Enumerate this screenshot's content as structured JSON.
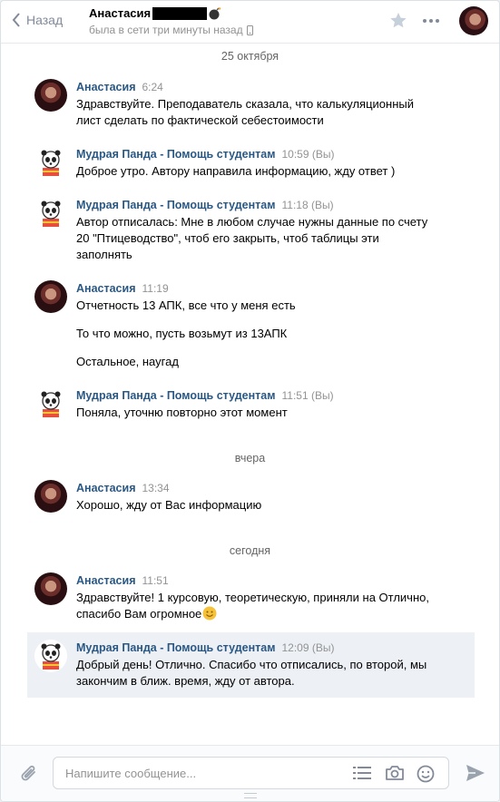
{
  "header": {
    "back_label": "Назад",
    "contact_name": "Анастасия",
    "status": "была в сети три минуты назад"
  },
  "dates": [
    "25 октября",
    "вчера",
    "сегодня"
  ],
  "messages": [
    {
      "author": "Анастасия",
      "time": "6:24",
      "lines": [
        "Здравствуйте. Преподаватель сказала, что калькуляционный лист сделать по фактической себестоимости"
      ]
    },
    {
      "author": "Мудрая Панда - Помощь студентам",
      "time": "10:59 (Вы)",
      "lines": [
        "Доброе утро. Автору направила информацию, жду ответ )"
      ]
    },
    {
      "author": "Мудрая Панда - Помощь студентам",
      "time": "11:18 (Вы)",
      "lines": [
        "Автор отписалась: Мне в любом случае нужны данные по счету 20 \"Птицеводство\", чтоб его закрыть, чтоб таблицы эти заполнять"
      ]
    },
    {
      "author": "Анастасия",
      "time": "11:19",
      "lines": [
        "Отчетность 13 АПК, все что у меня есть",
        "То что можно, пусть возьмут из 13АПК",
        "Остальное, наугад"
      ]
    },
    {
      "author": "Мудрая Панда - Помощь студентам",
      "time": "11:51 (Вы)",
      "lines": [
        "Поняла, уточню повторно этот момент"
      ]
    },
    {
      "author": "Анастасия",
      "time": "13:34",
      "lines": [
        "Хорошо, жду от Вас информацию"
      ]
    },
    {
      "author": "Анастасия",
      "time": "11:51",
      "lines": [
        "Здравствуйте! 1 курсовую, теоретическую, приняли на Отлично, спасибо Вам огромное"
      ]
    },
    {
      "author": "Мудрая Панда - Помощь студентам",
      "time": "12:09 (Вы)",
      "lines": [
        "Добрый день! Отлично. Спасибо что отписались, по второй, мы закончим в ближ. время, жду от автора."
      ]
    }
  ],
  "composer": {
    "placeholder": "Напишите сообщение..."
  },
  "colors": {
    "link": "#2a5885",
    "muted": "#939393",
    "selected_bg": "#edf0f5",
    "emoji": "#f5c23a"
  }
}
